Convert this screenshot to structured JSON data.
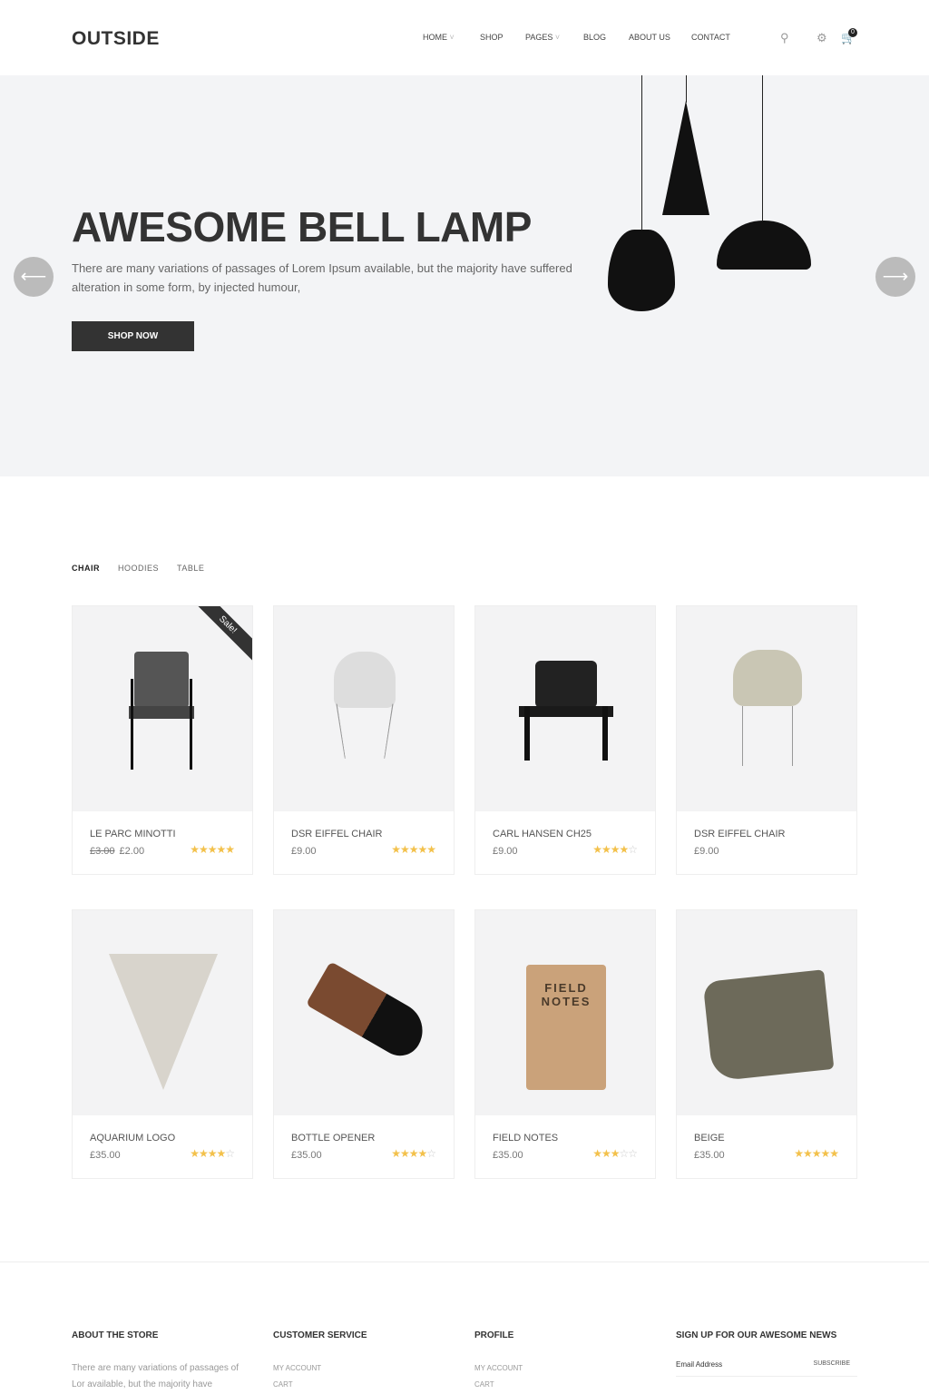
{
  "header": {
    "logo": "OUTSIDE",
    "nav": [
      "HOME",
      "SHOP",
      "PAGES",
      "BLOG",
      "ABOUT US",
      "CONTACT"
    ],
    "cart_count": "0",
    "icons": [
      "search-icon",
      "gear-icon",
      "cart-icon"
    ]
  },
  "hero": {
    "title": "AWESOME BELL LAMP",
    "text": "There are many variations of passages of Lorem Ipsum available, but the majority have suffered alteration in some form, by injected humour,",
    "button": "SHOP NOW"
  },
  "tabs": [
    "CHAIR",
    "HOODIES",
    "TABLE"
  ],
  "products": [
    {
      "name": "LE PARC MINOTTI",
      "old_price": "£3.00",
      "price": "£2.00",
      "rating": 4.5,
      "sale": "Sale!"
    },
    {
      "name": "DSR EIFFEL CHAIR",
      "price": "£9.00",
      "rating": 5
    },
    {
      "name": "CARL HANSEN CH25",
      "price": "£9.00",
      "rating": 4
    },
    {
      "name": "DSR EIFFEL CHAIR",
      "price": "£9.00",
      "rating": 0
    },
    {
      "name": "AQUARIUM LOGO",
      "price": "£35.00",
      "rating": 4
    },
    {
      "name": "BOTTLE OPENER",
      "price": "£35.00",
      "rating": 4
    },
    {
      "name": "FIELD NOTES",
      "price": "£35.00",
      "rating": 3,
      "label": "FIELD NOTES"
    },
    {
      "name": "BEIGE",
      "price": "£35.00",
      "rating": 5
    }
  ],
  "footer": {
    "about": {
      "title": "ABOUT THE STORE",
      "text": "There are many variations of passages of Lor available, but the majority have"
    },
    "service": {
      "title": "CUSTOMER SERVICE",
      "links": [
        "MY ACCOUNT",
        "CART"
      ]
    },
    "profile": {
      "title": "PROFILE",
      "links": [
        "MY ACCOUNT",
        "CART"
      ]
    },
    "newsletter": {
      "title": "SIGN UP FOR OUR AWESOME NEWS",
      "placeholder": "Email Address",
      "button": "SUBSCRIBE"
    }
  }
}
